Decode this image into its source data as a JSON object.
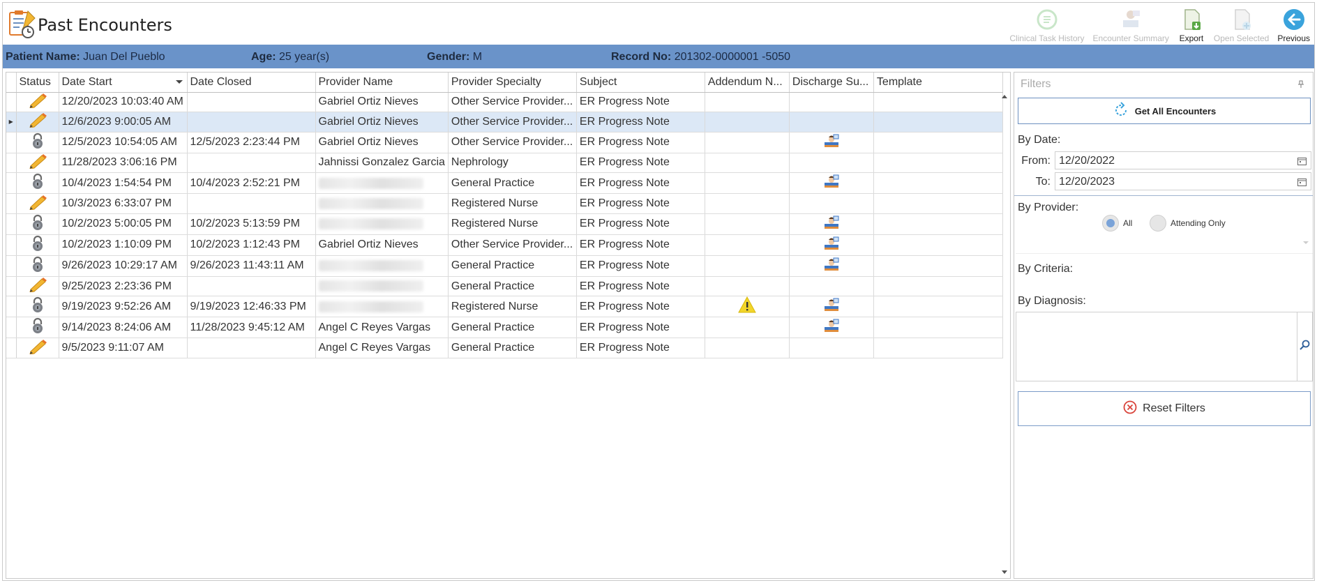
{
  "header": {
    "title": "Past Encounters",
    "toolbar": [
      {
        "label": "Clinical Task History",
        "icon": "clinical-task-history-icon",
        "enabled": false
      },
      {
        "label": "Encounter Summary",
        "icon": "encounter-summary-icon",
        "enabled": false
      },
      {
        "label": "Export",
        "icon": "export-icon",
        "enabled": true
      },
      {
        "label": "Open Selected",
        "icon": "open-selected-icon",
        "enabled": false
      },
      {
        "label": "Previous",
        "icon": "previous-icon",
        "enabled": true
      }
    ]
  },
  "patient": {
    "name_label": "Patient Name:",
    "name": "Juan Del Pueblo",
    "age_label": "Age:",
    "age": "25 year(s)",
    "gender_label": "Gender:",
    "gender": "M",
    "record_label": "Record No:",
    "record": "201302-0000001 -5050"
  },
  "grid": {
    "columns": [
      "Status",
      "Date Start",
      "Date Closed",
      "Provider Name",
      "Provider Specialty",
      "Subject",
      "Addendum N...",
      "Discharge Su...",
      "Template"
    ],
    "rows": [
      {
        "status": "edit",
        "date_start": "12/20/2023 10:03:40 AM",
        "date_closed": "",
        "provider": "Gabriel Ortiz Nieves",
        "specialty": "Other Service Provider...",
        "subject": "ER Progress Note",
        "addendum": "",
        "discharge": false,
        "template": ""
      },
      {
        "status": "edit",
        "date_start": "12/6/2023 9:00:05 AM",
        "date_closed": "",
        "provider": "Gabriel Ortiz Nieves",
        "specialty": "Other Service Provider...",
        "subject": "ER Progress Note",
        "addendum": "",
        "discharge": false,
        "template": "",
        "selected": true
      },
      {
        "status": "locked",
        "date_start": "12/5/2023 10:54:05 AM",
        "date_closed": "12/5/2023 2:23:44 PM",
        "provider": "Gabriel Ortiz Nieves",
        "specialty": "Other Service Provider...",
        "subject": "ER Progress Note",
        "addendum": "",
        "discharge": true,
        "template": ""
      },
      {
        "status": "edit",
        "date_start": "11/28/2023 3:06:16 PM",
        "date_closed": "",
        "provider": "Jahnissi Gonzalez Garcia",
        "specialty": "Nephrology",
        "subject": "ER Progress Note",
        "addendum": "",
        "discharge": false,
        "template": ""
      },
      {
        "status": "locked",
        "date_start": "10/4/2023 1:54:54 PM",
        "date_closed": "10/4/2023 2:52:21 PM",
        "provider": "",
        "provider_blurred": true,
        "specialty": "General Practice",
        "subject": "ER Progress Note",
        "addendum": "",
        "discharge": true,
        "template": ""
      },
      {
        "status": "edit",
        "date_start": "10/3/2023 6:33:07 PM",
        "date_closed": "",
        "provider": "",
        "provider_blurred": true,
        "specialty": "Registered Nurse",
        "subject": "ER Progress Note",
        "addendum": "",
        "discharge": false,
        "template": ""
      },
      {
        "status": "locked",
        "date_start": "10/2/2023 5:00:05 PM",
        "date_closed": "10/2/2023 5:13:59 PM",
        "provider": "",
        "provider_blurred": true,
        "specialty": "Registered Nurse",
        "subject": "ER Progress Note",
        "addendum": "",
        "discharge": true,
        "template": ""
      },
      {
        "status": "locked",
        "date_start": "10/2/2023 1:10:09 PM",
        "date_closed": "10/2/2023 1:12:43 PM",
        "provider": "Gabriel Ortiz Nieves",
        "specialty": "Other Service Provider...",
        "subject": "ER Progress Note",
        "addendum": "",
        "discharge": true,
        "template": ""
      },
      {
        "status": "locked",
        "date_start": "9/26/2023 10:29:17 AM",
        "date_closed": "9/26/2023 11:43:11 AM",
        "provider": "",
        "provider_blurred": true,
        "specialty": "General Practice",
        "subject": "ER Progress Note",
        "addendum": "",
        "discharge": true,
        "template": ""
      },
      {
        "status": "edit",
        "date_start": "9/25/2023 2:23:36 PM",
        "date_closed": "",
        "provider": "",
        "provider_blurred": true,
        "specialty": "General Practice",
        "subject": "ER Progress Note",
        "addendum": "",
        "discharge": false,
        "template": ""
      },
      {
        "status": "locked",
        "date_start": "9/19/2023 9:52:26 AM",
        "date_closed": "9/19/2023 12:46:33 PM",
        "provider": "",
        "provider_blurred": true,
        "specialty": "Registered Nurse",
        "subject": "ER Progress Note",
        "addendum": "warning",
        "discharge": true,
        "template": ""
      },
      {
        "status": "locked",
        "date_start": "9/14/2023 8:24:06 AM",
        "date_closed": "11/28/2023 9:45:12 AM",
        "provider": "Angel C Reyes Vargas",
        "specialty": "General Practice",
        "subject": "ER Progress Note",
        "addendum": "",
        "discharge": true,
        "template": ""
      },
      {
        "status": "edit",
        "date_start": "9/5/2023 9:11:07 AM",
        "date_closed": "",
        "provider": "Angel C Reyes Vargas",
        "specialty": "General Practice",
        "subject": "ER Progress Note",
        "addendum": "",
        "discharge": false,
        "template": ""
      }
    ]
  },
  "filters": {
    "title": "Filters",
    "get_all_label": "Get All Encounters",
    "by_date_label": "By Date:",
    "from_label": "From:",
    "from_value": "12/20/2022",
    "to_label": "To:",
    "to_value": "12/20/2023",
    "by_provider_label": "By Provider:",
    "radio_all": "All",
    "radio_attending": "Attending Only",
    "by_criteria_label": "By Criteria:",
    "by_diagnosis_label": "By Diagnosis:",
    "reset_label": "Reset Filters"
  },
  "colors": {
    "patient_bar": "#6a93c9",
    "selected_row": "#dce8f6",
    "accent": "#3aa3dc"
  }
}
